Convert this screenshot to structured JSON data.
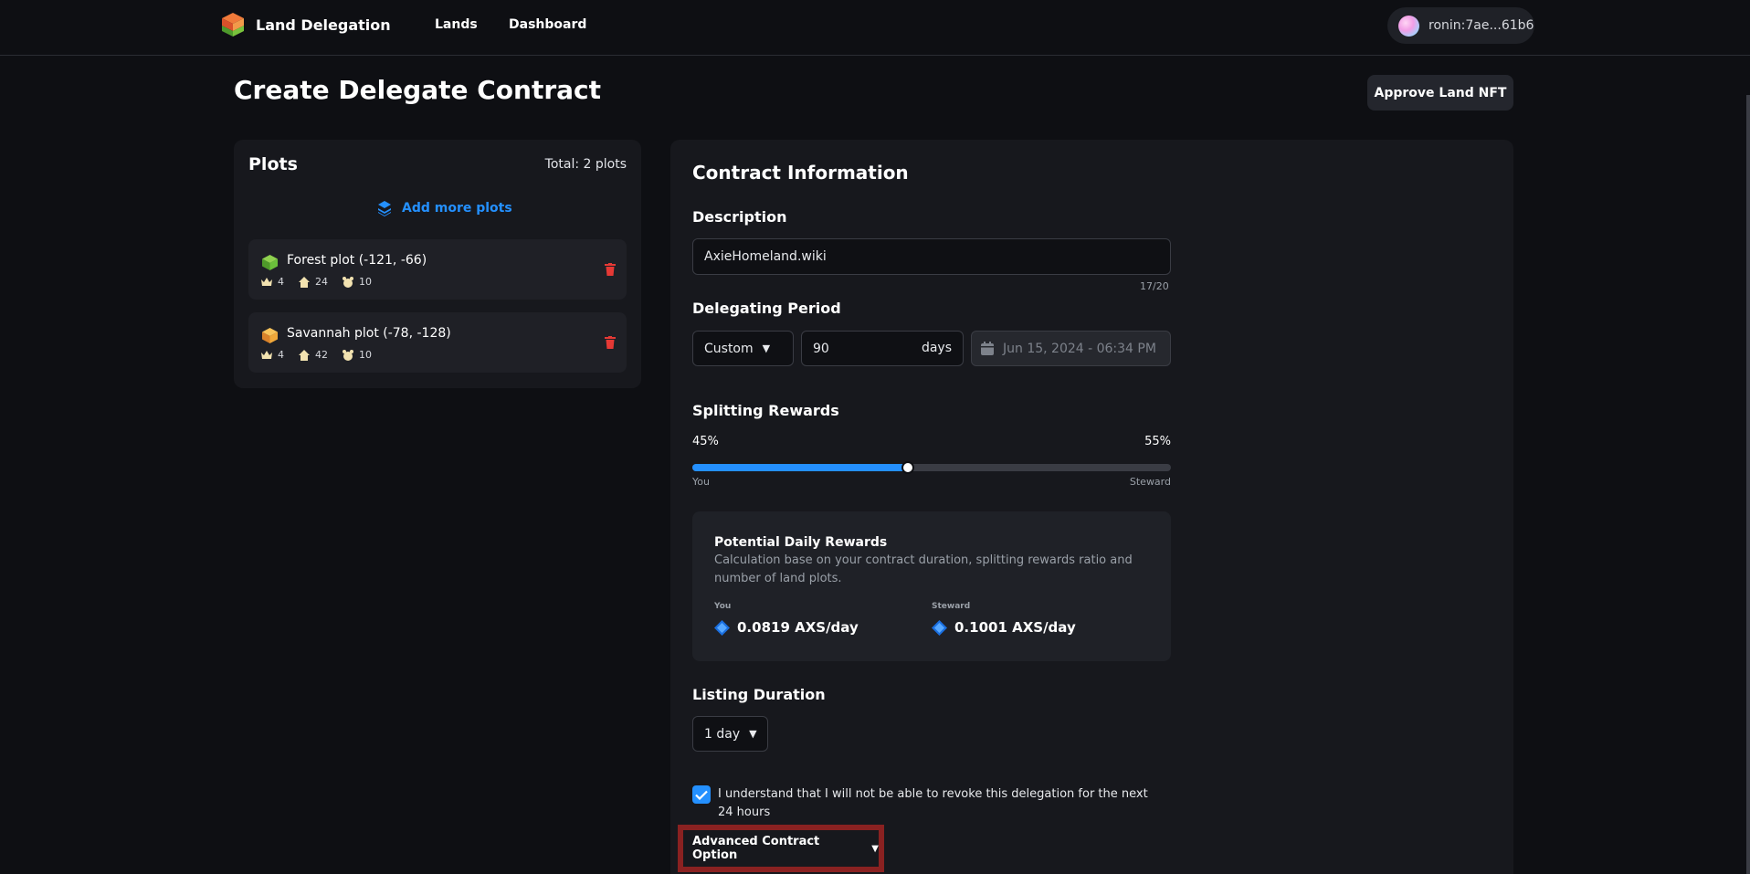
{
  "header": {
    "brand": "Land Delegation",
    "nav": [
      "Lands",
      "Dashboard"
    ],
    "wallet": "ronin:7ae...61b6"
  },
  "page": {
    "title": "Create Delegate Contract",
    "approve_label": "Approve Land NFT"
  },
  "plots": {
    "title": "Plots",
    "total": "Total: 2 plots",
    "add_label": "Add more plots",
    "items": [
      {
        "name": "Forest plot (-121, -66)",
        "crowns": "4",
        "homes": "24",
        "axies": "10",
        "color": "#6abf3b"
      },
      {
        "name": "Savannah plot (-78, -128)",
        "crowns": "4",
        "homes": "42",
        "axies": "10",
        "color": "#f0a83a"
      }
    ]
  },
  "contract": {
    "title": "Contract Information",
    "description_label": "Description",
    "description_value": "AxieHomeland.wiki",
    "description_counter": "17/20",
    "period_label": "Delegating Period",
    "period_mode": "Custom",
    "period_days": "90",
    "period_unit": "days",
    "period_date": "Jun 15, 2024 - 06:34 PM",
    "split_label": "Splitting Rewards",
    "split_you_pct": "45%",
    "split_steward_pct": "55%",
    "split_you_fraction": 0.45,
    "split_you_caption": "You",
    "split_steward_caption": "Steward",
    "rewards_title": "Potential Daily Rewards",
    "rewards_desc": "Calculation base on your contract duration, splitting rewards ratio and number of land plots.",
    "rewards_you_label": "You",
    "rewards_you_value": "0.0819 AXS/day",
    "rewards_steward_label": "Steward",
    "rewards_steward_value": "0.1001 AXS/day",
    "listing_label": "Listing Duration",
    "listing_value": "1 day",
    "acknowledge_text": "I understand that I will not be able to revoke this delegation for the next 24 hours",
    "acknowledge_checked": true,
    "advanced_label": "Advanced Contract Option"
  },
  "colors": {
    "accent": "#2490ff",
    "danger": "#e53935",
    "highlight": "#8a2121"
  }
}
